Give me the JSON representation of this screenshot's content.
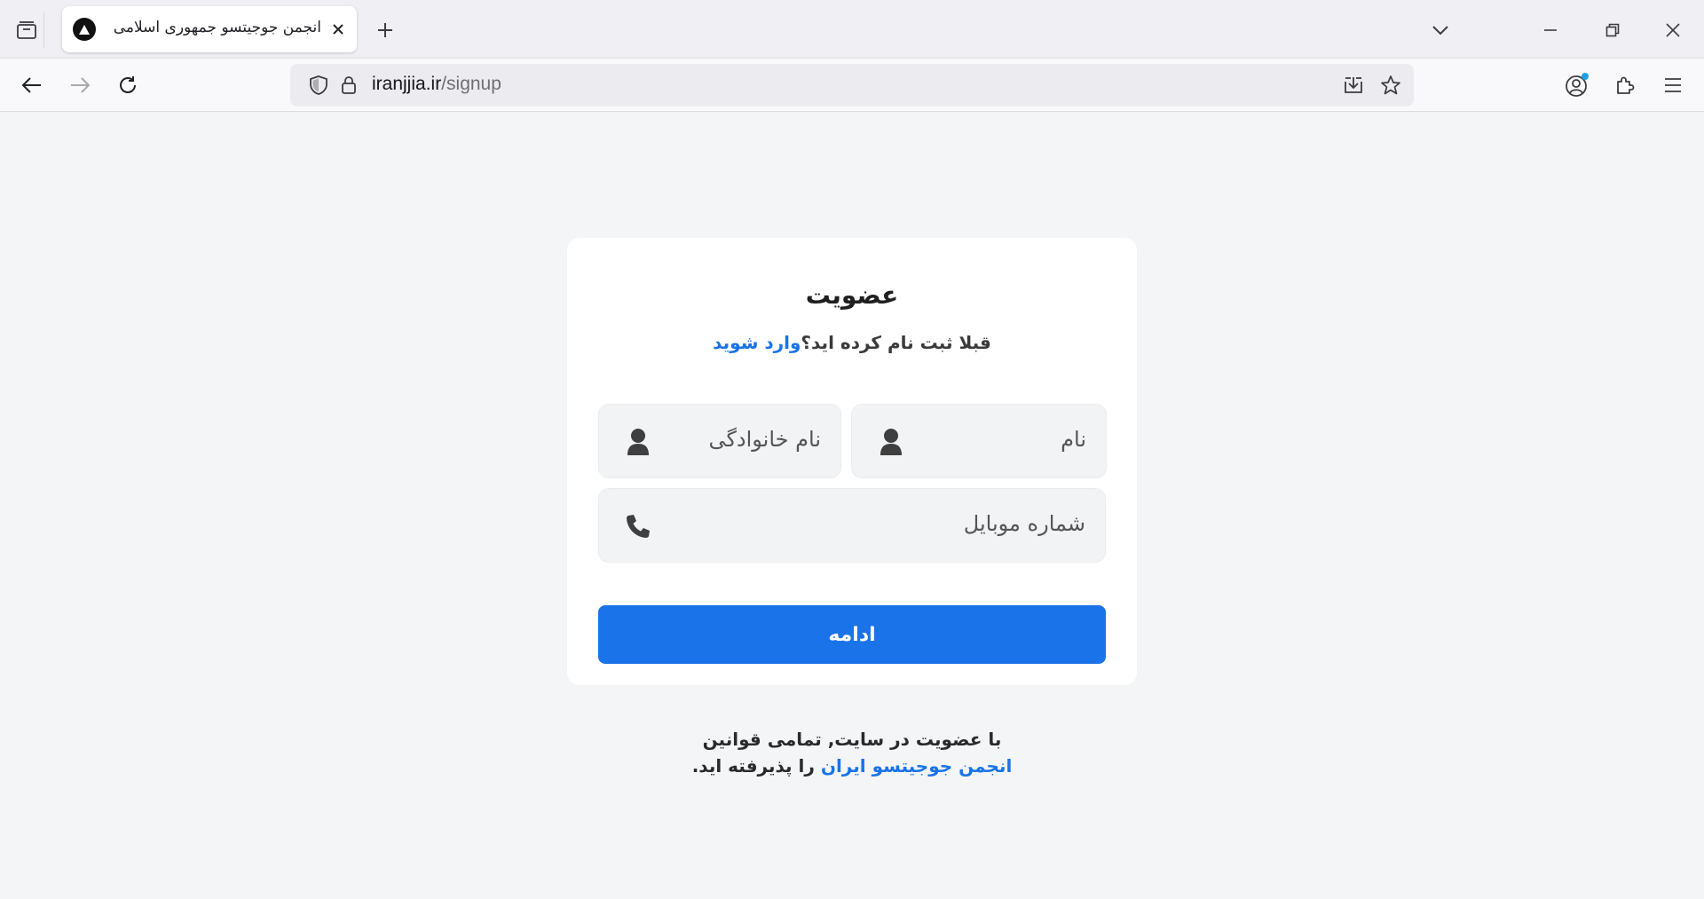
{
  "browser": {
    "tab": {
      "title": "انجمن جوجیتسو جمهوری اسلامی"
    },
    "url": {
      "domain": "iranjjia.ir",
      "path": "/signup"
    },
    "icons": {
      "tab_list": "tab-list-icon",
      "favicon": "triangle-logo-icon",
      "close": "close-icon",
      "new_tab": "plus-icon",
      "dropdown": "chevron-down-icon",
      "minimize": "minimize-icon",
      "restore": "restore-icon",
      "window_close": "close-icon",
      "back": "back-arrow-icon",
      "forward": "forward-arrow-icon",
      "reload": "reload-icon",
      "shield": "shield-icon",
      "lock": "lock-icon",
      "save": "download-icon",
      "bookmark": "star-icon",
      "account": "account-icon",
      "extensions": "puzzle-icon",
      "menu": "hamburger-menu-icon"
    }
  },
  "signup": {
    "title": "عضویت",
    "login_prompt": "قبلا ثبت نام کرده اید؟",
    "login_link": "وارد شوید",
    "first_name_placeholder": "نام",
    "last_name_placeholder": "نام خانوادگی",
    "mobile_placeholder": "شماره موبایل",
    "submit_label": "ادامه",
    "terms_prefix": "با عضویت در سایت, تمامی قوانین",
    "terms_link": "انجمن جوجیتسو ایران",
    "terms_suffix": " را پذیرفته اید."
  },
  "colors": {
    "accent": "#1a73e8",
    "page_bg": "#f4f5f7",
    "card_bg": "#ffffff",
    "field_bg": "#f2f3f5"
  }
}
